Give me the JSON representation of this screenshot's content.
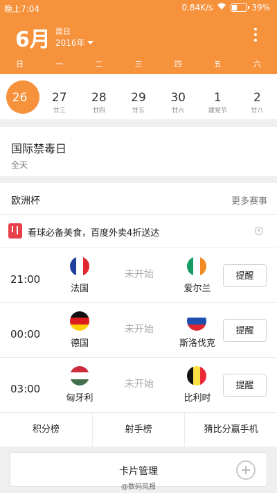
{
  "status_bar": {
    "time": "晚上7:04",
    "network": "0.84K/s",
    "battery": "39%"
  },
  "header": {
    "month": "6月",
    "weekday": "周日",
    "year": "2016年"
  },
  "weekdays": [
    "日",
    "一",
    "二",
    "三",
    "四",
    "五",
    "六"
  ],
  "week": [
    {
      "num": "26",
      "sub": ""
    },
    {
      "num": "27",
      "sub": "廿三"
    },
    {
      "num": "28",
      "sub": "廿四"
    },
    {
      "num": "29",
      "sub": "廿五"
    },
    {
      "num": "30",
      "sub": "廿六"
    },
    {
      "num": "1",
      "sub": "建党节"
    },
    {
      "num": "2",
      "sub": "廿八"
    }
  ],
  "event": {
    "title": "国际禁毒日",
    "subtitle": "全天"
  },
  "euro": {
    "title": "欧洲杯",
    "more": "更多赛事",
    "promo": "看球必备美食，百度外卖4折送达",
    "close": "✕",
    "matches": [
      {
        "time": "21:00",
        "home": "法国",
        "away": "爱尔兰",
        "status": "未开始",
        "button": "提醒"
      },
      {
        "time": "00:00",
        "home": "德国",
        "away": "斯洛伐克",
        "status": "未开始",
        "button": "提醒"
      },
      {
        "time": "03:00",
        "home": "匈牙利",
        "away": "比利时",
        "status": "未开始",
        "button": "提醒"
      }
    ],
    "tabs": [
      "积分榜",
      "射手榜",
      "猜比分赢手机"
    ]
  },
  "card_management": "卡片管理",
  "watermark": "@数码风报",
  "colors": {
    "accent": "#f6913c",
    "promo": "#e8404a"
  }
}
